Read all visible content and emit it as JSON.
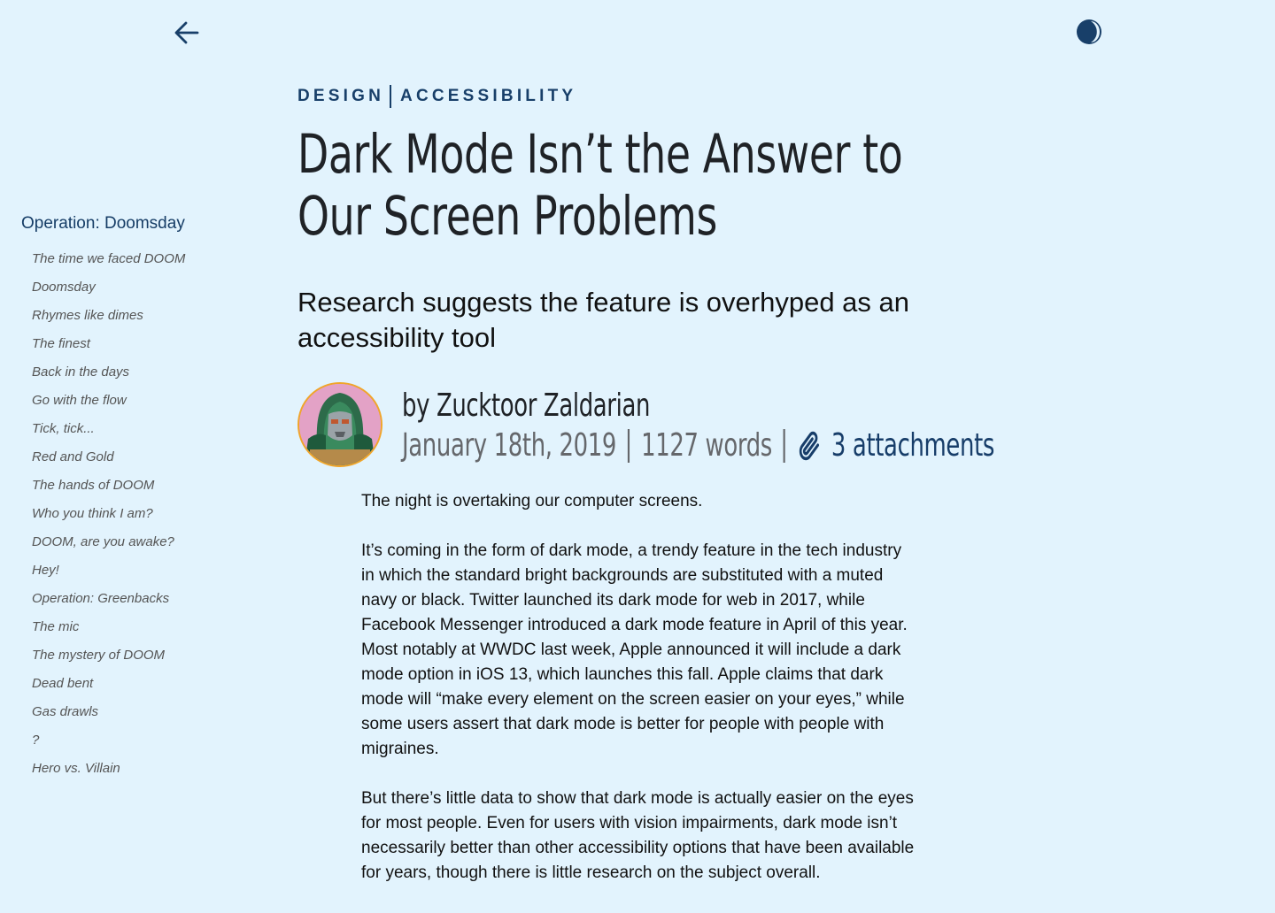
{
  "toolbar": {
    "back_icon": "arrow-left-icon",
    "theme_icon": "half-moon-icon"
  },
  "colors": {
    "background": "#e2f3fd",
    "accent": "#183f69",
    "avatar_border": "#f0a52a"
  },
  "sidebar": {
    "title": "Operation: Doomsday",
    "items": [
      "The time we faced DOOM",
      "Doomsday",
      "Rhymes like dimes",
      "The finest",
      "Back in the days",
      "Go with the flow",
      "Tick, tick...",
      "Red and Gold",
      "The hands of DOOM",
      "Who you think I am?",
      "DOOM, are you awake?",
      "Hey!",
      "Operation: Greenbacks",
      "The mic",
      "The mystery of DOOM",
      "Dead bent",
      "Gas drawls",
      "?",
      "Hero vs. Villain"
    ]
  },
  "article": {
    "tags": [
      "DESIGN",
      "ACCESSIBILITY"
    ],
    "title": "Dark Mode Isn’t the Answer to Our Screen Problems",
    "dek": "Research suggests the feature is overhyped as an accessibility tool",
    "author": "by Zucktoor Zaldarian",
    "date": "January 18th, 2019",
    "word_count": "1127 words",
    "attachments": "3 attachments",
    "paragraphs": [
      "The night is overtaking our computer screens.",
      "It’s coming in the form of dark mode, a trendy feature in the tech industry in which the standard bright backgrounds are substituted with a muted navy or black. Twitter launched its dark mode for web in 2017, while Facebook Messenger introduced a dark mode feature in April of this year. Most notably at WWDC last week, Apple announced it will include a dark mode option in iOS 13, which launches this fall. Apple claims that dark mode will “make every element on the screen easier on your eyes,” while some users assert that dark mode is better for people with people with migraines.",
      "But there’s little data to show that dark mode is actually easier on the eyes for most people. Even for users with vision impairments, dark mode isn’t necessarily better than other accessibility options that have been available for years, though there is little research on the subject overall."
    ]
  }
}
